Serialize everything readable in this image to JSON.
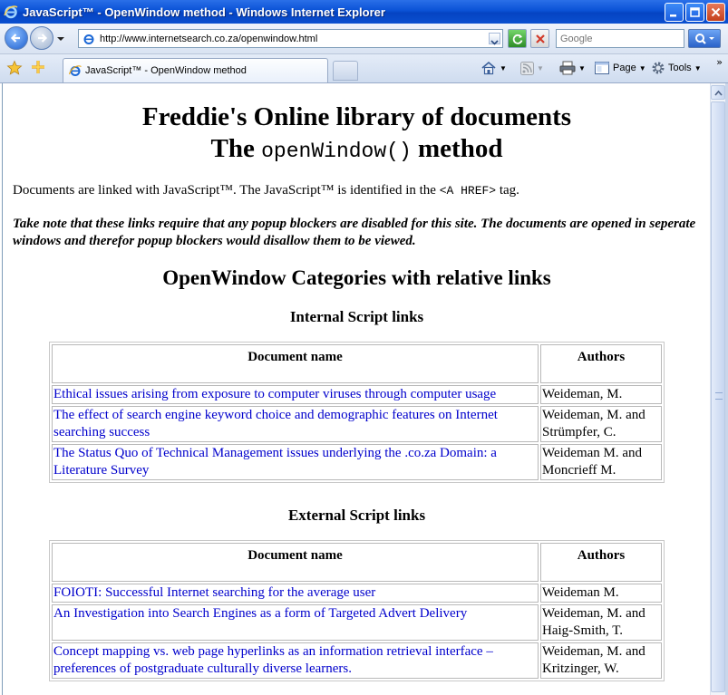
{
  "window": {
    "title": "JavaScript™ - OpenWindow method - Windows Internet Explorer"
  },
  "address": {
    "url": "http://www.internetsearch.co.za/openwindow.html"
  },
  "search": {
    "placeholder": "Google"
  },
  "tab": {
    "label": "JavaScript™ - OpenWindow method"
  },
  "commands": {
    "page": "Page",
    "tools": "Tools",
    "more": "»"
  },
  "icons": {
    "back": "back-arrow-icon",
    "forward": "forward-arrow-icon",
    "refresh": "refresh-icon",
    "stop": "stop-icon",
    "search": "magnifier-icon",
    "favorites": "star-icon",
    "add_favorite": "plus-star-icon",
    "home": "home-icon",
    "feeds": "rss-icon",
    "print": "printer-icon",
    "page": "page-icon",
    "tools": "gear-icon"
  },
  "page": {
    "heading_line1": "Freddie's Online library of documents",
    "heading_line2_pre": "The ",
    "heading_line2_code": "openWindow()",
    "heading_line2_post": " method",
    "intro_pre": "Documents are linked with JavaScript™. The JavaScript™ is identified in the ",
    "intro_code": "<A HREF>",
    "intro_post": " tag.",
    "note": "Take note that these links require that any popup blockers are disabled for this site. The documents are opened in seperate windows and therefor popup blockers would disallow them to be viewed.",
    "categories_heading": "OpenWindow Categories with relative links"
  },
  "internal": {
    "heading": "Internal Script links",
    "col_name": "Document name",
    "col_authors": "Authors",
    "rows": [
      {
        "name": "Ethical issues arising from exposure to computer viruses through computer usage",
        "authors": "Weideman, M."
      },
      {
        "name": "The effect of search engine keyword choice and demographic features on Internet searching success",
        "authors": "Weideman, M. and Strümpfer, C."
      },
      {
        "name": "The Status Quo of Technical Management issues underlying the .co.za Domain: a Literature Survey",
        "authors": "Weideman M. and Moncrieff M."
      }
    ]
  },
  "external": {
    "heading": "External Script links",
    "col_name": "Document name",
    "col_authors": "Authors",
    "rows": [
      {
        "name": "FOIOTI: Successful Internet searching for the average user",
        "authors": "Weideman M."
      },
      {
        "name": "An Investigation into Search Engines as a form of Targeted Advert Delivery",
        "authors": "Weideman, M. and Haig-Smith, T."
      },
      {
        "name": "Concept mapping vs. web page hyperlinks as an information retrieval interface – preferences of postgraduate culturally diverse learners.",
        "authors": "Weideman, M. and Kritzinger, W."
      }
    ]
  }
}
